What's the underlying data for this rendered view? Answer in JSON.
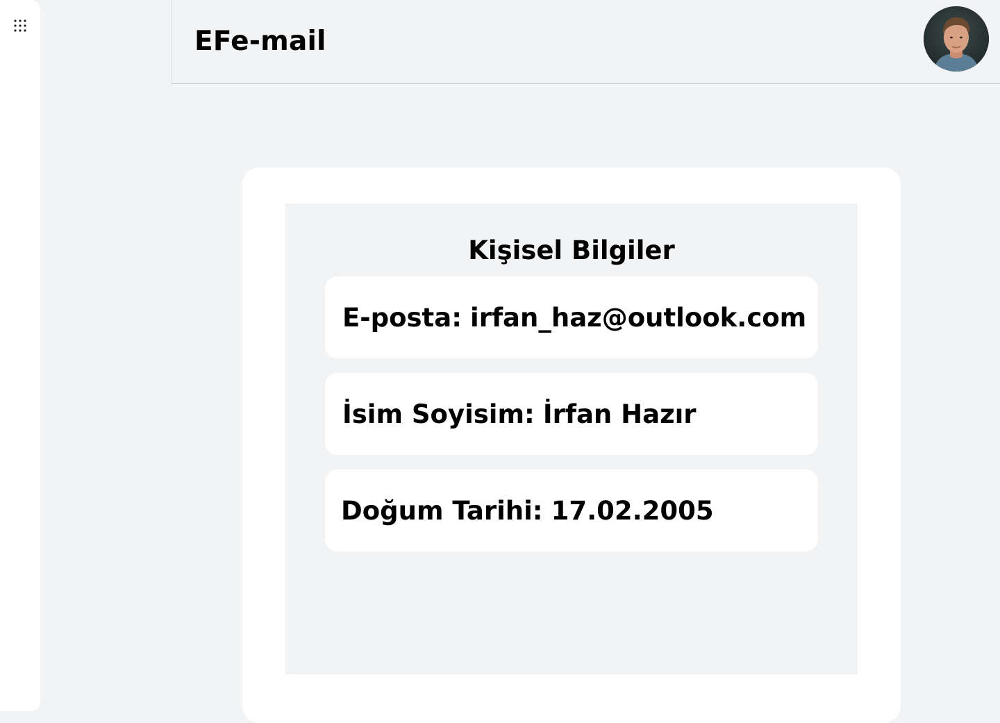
{
  "rail": {
    "apps_icon": "apps-grid-icon"
  },
  "header": {
    "brand": "EFe-mail",
    "avatar_icon": "user-avatar"
  },
  "profile": {
    "title": "Kişisel Bilgiler",
    "fields": [
      {
        "label": "E-posta:",
        "value": "irfan_haz@outlook.com"
      },
      {
        "label": "İsim Soyisim:",
        "value": "İrfan Hazır"
      },
      {
        "label": "Doğum Tarihi:",
        "value": "17.02.2005"
      }
    ]
  },
  "colors": {
    "background": "#f2f3f5",
    "card": "#ffffff",
    "text": "#000000",
    "divider": "#c8c9cc"
  }
}
